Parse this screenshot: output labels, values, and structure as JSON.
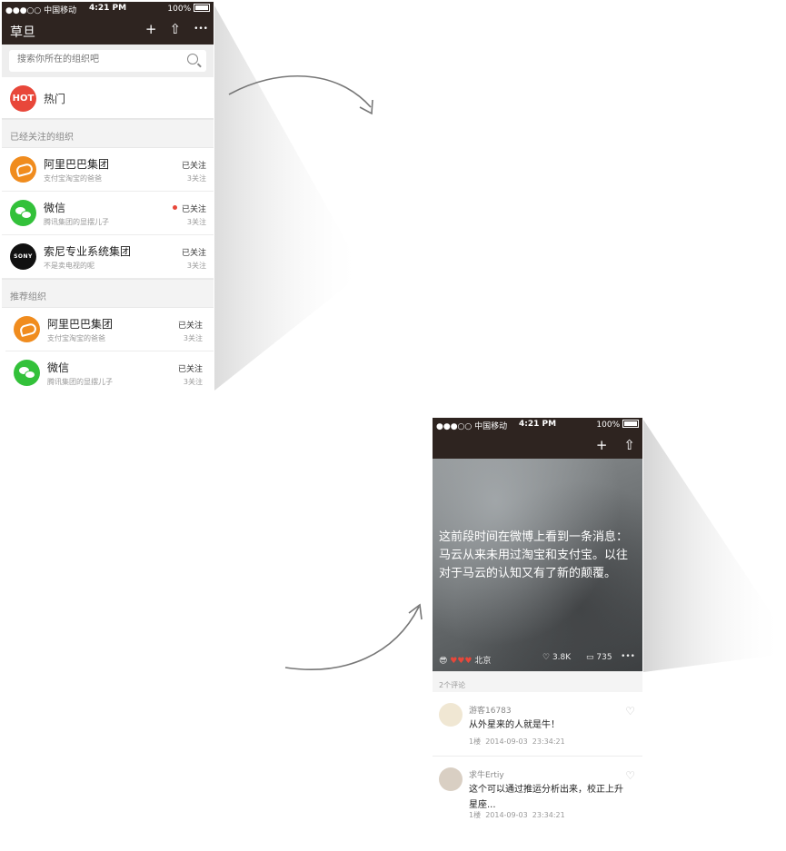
{
  "phone1": {
    "status": {
      "carrier": "●●●○○ 中国移动",
      "time": "4:21 PM",
      "battery": "100%"
    },
    "nav": {
      "title": "草旦",
      "add_icon": "+",
      "share_icon": "⇧",
      "more_icon": "•••"
    },
    "search": {
      "placeholder": "搜索你所在的组织吧"
    },
    "hot": {
      "badge": "HOT",
      "label": "热门"
    },
    "followed_header": "已经关注的组织",
    "followed": [
      {
        "name": "阿里巴巴集团",
        "desc": "支付宝淘宝的爸爸",
        "status": "已关注",
        "count": "3关注"
      },
      {
        "name": "微信",
        "desc": "腾讯集团的显摆儿子",
        "status": "已关注",
        "count": "3关注"
      },
      {
        "name": "索尼专业系统集团",
        "desc": "不是卖电视的呢",
        "status": "已关注",
        "count": "3关注",
        "logo": "SONY"
      }
    ],
    "recommended_header": "推荐组织",
    "recommended": [
      {
        "name": "阿里巴巴集团",
        "desc": "支付宝淘宝的爸爸",
        "status": "已关注",
        "count": "3关注"
      },
      {
        "name": "微信",
        "desc": "腾讯集团的显摆儿子",
        "status": "已关注",
        "count": "3关注"
      }
    ]
  },
  "phone2": {
    "status": {
      "carrier": "●●●○○ 中国移动",
      "time": "4:21 PM",
      "battery": "100%"
    },
    "post": {
      "text": "这前段时间在微博上看到一条消息：马云从来未用过淘宝和支付宝。以往对于马云的认知又有了新的颠覆。",
      "location": "北京",
      "likes": "3.8K",
      "comments": "735"
    },
    "comments_header": "2个评论",
    "comments": [
      {
        "user": "游客16783",
        "text": "从外星来的人就是牛！",
        "floor": "1楼",
        "date": "2014-09-03",
        "time": "23:34:21"
      },
      {
        "user": "求牛Ertiy",
        "text": "这个可以通过推运分析出来，校正上升星座...",
        "floor": "1楼",
        "date": "2014-09-03",
        "time": "23:34:21"
      }
    ]
  }
}
